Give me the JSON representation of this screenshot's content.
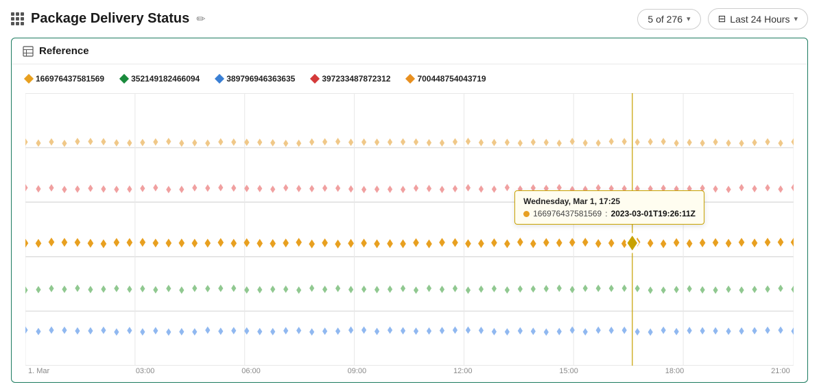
{
  "header": {
    "grid_icon_label": "apps",
    "title": "Package Delivery Status",
    "edit_icon": "✏",
    "pagination": {
      "label": "5 of 276",
      "chevron": "▾"
    },
    "time_filter": {
      "icon": "⊟",
      "label": "Last 24 Hours",
      "chevron": "▾"
    }
  },
  "card": {
    "title": "Reference"
  },
  "legend": [
    {
      "id": "leg1",
      "color": "#e8a020",
      "label": "166976437581569"
    },
    {
      "id": "leg2",
      "color": "#1a8a3c",
      "label": "352149182466094"
    },
    {
      "id": "leg3",
      "color": "#3a7fd4",
      "label": "389796946363635"
    },
    {
      "id": "leg4",
      "color": "#d43a3a",
      "label": "397233487872312"
    },
    {
      "id": "leg5",
      "color": "#e89020",
      "label": "700448754043719"
    }
  ],
  "tooltip": {
    "title": "Wednesday, Mar 1, 17:25",
    "dot_color": "#e8a020",
    "series_label": "166976437581569",
    "value": "2023-03-01T19:26:11Z"
  },
  "x_axis_labels": [
    "1. Mar",
    "03:00",
    "06:00",
    "09:00",
    "12:00",
    "15:00",
    "18:00",
    "21:00"
  ],
  "chart": {
    "series": [
      {
        "id": "s_orange_light",
        "color": "#f0c080",
        "y_pct": 18
      },
      {
        "id": "s_pink",
        "color": "#f0a0a0",
        "y_pct": 35
      },
      {
        "id": "s_gold",
        "color": "#e8a020",
        "y_pct": 55
      },
      {
        "id": "s_green",
        "color": "#80c080",
        "y_pct": 72
      },
      {
        "id": "s_blue",
        "color": "#80a8e8",
        "y_pct": 87
      }
    ],
    "tooltip_x_pct": 79
  }
}
